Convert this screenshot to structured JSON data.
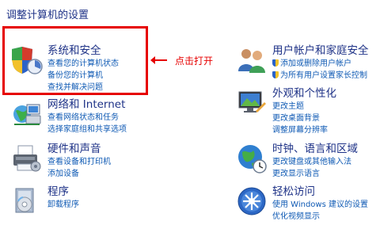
{
  "page": {
    "title": "调整计算机的设置"
  },
  "annotation": {
    "text": "点击打开"
  },
  "categories": {
    "system_security": {
      "title": "系统和安全",
      "links": [
        "查看您的计算机状态",
        "备份您的计算机",
        "查找并解决问题"
      ]
    },
    "network": {
      "title": "网络和 Internet",
      "links": [
        "查看网络状态和任务",
        "选择家庭组和共享选项"
      ]
    },
    "hardware": {
      "title": "硬件和声音",
      "links": [
        "查看设备和打印机",
        "添加设备"
      ]
    },
    "programs": {
      "title": "程序",
      "links": [
        "卸载程序"
      ]
    },
    "user_accounts": {
      "title": "用户帐户和家庭安全",
      "links": [
        "添加或删除用户帐户",
        "为所有用户设置家长控制"
      ]
    },
    "appearance": {
      "title": "外观和个性化",
      "links": [
        "更改主题",
        "更改桌面背景",
        "调整屏幕分辨率"
      ]
    },
    "clock_region": {
      "title": "时钟、语言和区域",
      "links": [
        "更改键盘或其他输入法",
        "更改显示语言"
      ]
    },
    "ease_access": {
      "title": "轻松访问",
      "links": [
        "使用 Windows 建议的设置",
        "优化视频显示"
      ]
    }
  },
  "colors": {
    "heading": "#1e3287",
    "link": "#0f5ab4",
    "highlight": "#e60000"
  }
}
